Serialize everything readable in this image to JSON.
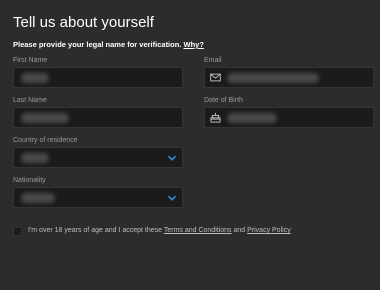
{
  "header": {
    "title": "Tell us about yourself",
    "subtitle": "Please provide your legal name for verification.",
    "why_link": "Why?"
  },
  "form": {
    "first_name_label": "First Name",
    "email_label": "Email",
    "last_name_label": "Last Name",
    "dob_label": "Date of Birth",
    "country_label": "Country of residence",
    "nationality_label": "Nationality"
  },
  "consent": {
    "text_before": "I'm over 18 years of age and I accept these ",
    "terms_link": "Terms and Conditions",
    "and": " and ",
    "privacy_link": "Privacy Policy"
  },
  "icons": {
    "email": "envelope-icon",
    "dob": "cake-icon",
    "select": "chevron-down-icon"
  },
  "colors": {
    "background": "#2c2c2c",
    "field_background": "#1b1b1b",
    "label": "#9a9a9a",
    "accent": "#2f8fd8"
  }
}
